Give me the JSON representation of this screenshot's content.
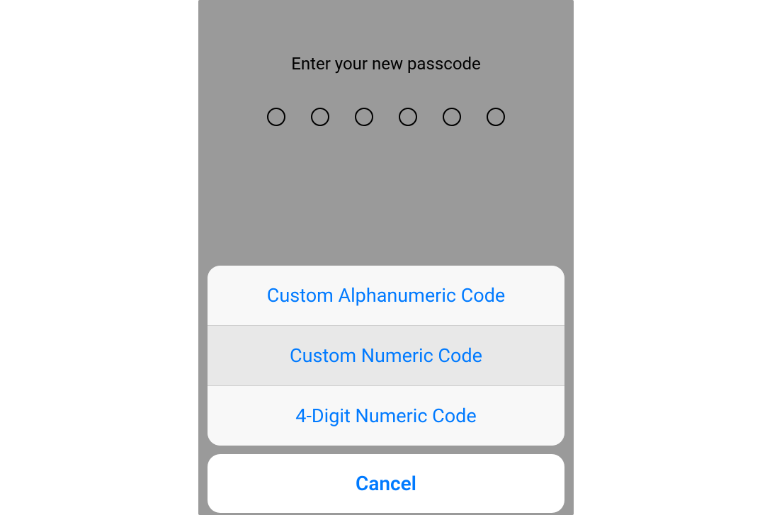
{
  "prompt": "Enter your new passcode",
  "passcode_length": 6,
  "sheet": {
    "options": [
      {
        "label": "Custom Alphanumeric Code",
        "highlighted": false
      },
      {
        "label": "Custom Numeric Code",
        "highlighted": true
      },
      {
        "label": "4-Digit Numeric Code",
        "highlighted": false
      }
    ],
    "cancel": "Cancel"
  }
}
